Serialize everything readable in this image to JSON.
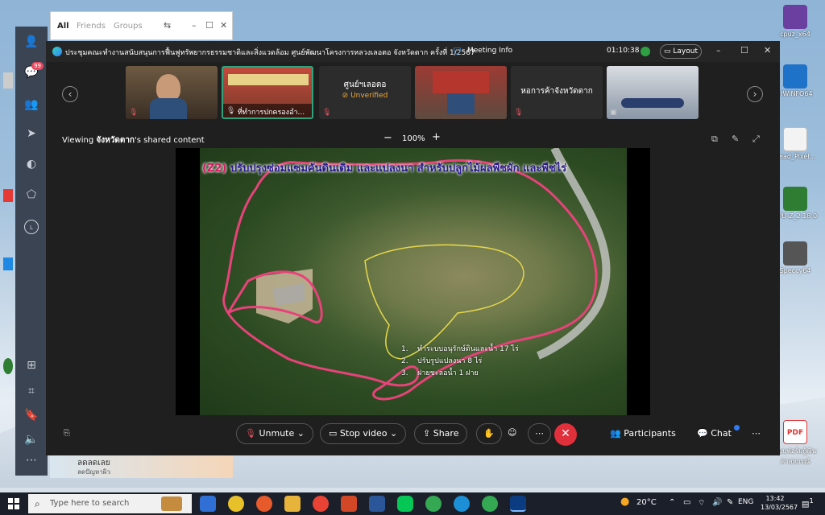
{
  "popup": {
    "tabs": [
      "All",
      "Friends",
      "Groups"
    ]
  },
  "desktop_icons": {
    "cpuz": "cpuz_x64",
    "hwinfo": "HWiNFO64",
    "read_pixel": "Read_Pixel...",
    "cpu_z": "CPU-Z_2.18.0",
    "speccy": "Speccy64",
    "pdf": "แบบฟอร์มกู้เงินค่าสหกรณ์"
  },
  "meeting": {
    "title": "ประชุมคณะทำงานสนับสนุนการฟื้นฟูทรัพยากรธรรมชาติและสิ่งแวดล้อม ศูนย์พัฒนาโครงการหลวงเลอตอ จังหวัดตาก ครั้งที่ 1/2567",
    "info_label": "Meeting Info",
    "timer": "01:10:38",
    "layout_label": "Layout",
    "participants_strip": [
      {
        "name": "",
        "kind": "video"
      },
      {
        "name": "ที่ทำการปกครองอำ...",
        "kind": "video"
      },
      {
        "name": "ศูนย์ฯเลอตอ",
        "kind": "avatar",
        "status": "Unverified"
      },
      {
        "name": "",
        "kind": "video"
      },
      {
        "name": "หอการค้าจังหวัดตาก",
        "kind": "avatar"
      },
      {
        "name": "",
        "kind": "video"
      }
    ],
    "viewing_prefix": "Viewing ",
    "viewing_name": "จังหวัดตาก",
    "viewing_suffix": "'s shared content",
    "zoom": "100%",
    "slide": {
      "title_tag": "(Z2)",
      "title": "ปรับปรุงซ่อมแซมคันดินเดิม และแปลงนา สำหรับปลูกไม้ผลพืชผัก และพืชไร่",
      "items": [
        {
          "num": "1.",
          "text": "ทำระบบอนุรักษ์ดินและน้ำ 17 ไร่"
        },
        {
          "num": "2.",
          "text": "ปรับรูปแปลงนา 8 ไร่"
        },
        {
          "num": "3.",
          "text": "ฝายชะลอน้ำ 1 ฝาย"
        }
      ]
    },
    "controls": {
      "unmute": "Unmute",
      "stop_video": "Stop video",
      "share": "Share",
      "participants": "Participants",
      "chat": "Chat"
    }
  },
  "thumb_card": {
    "line1": "ลดลดเลย",
    "line2": "ลดปัญหาผิว"
  },
  "taskbar": {
    "search_placeholder": "Type here to search",
    "weather": "20°C",
    "lang": "ENG",
    "time": "13:42",
    "date": "13/03/2567",
    "notif_count": "1"
  },
  "colors": {
    "meeting_bg": "#1f1f1f",
    "end_call": "#e0303c",
    "route_line": "#e8427a",
    "area_outline": "#e6d84a"
  }
}
